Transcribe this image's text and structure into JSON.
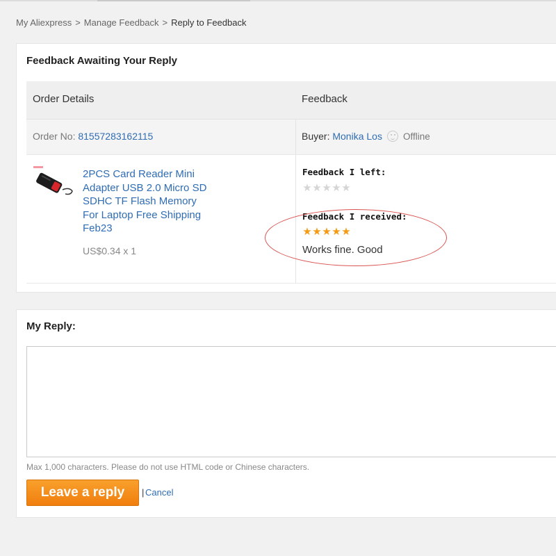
{
  "breadcrumb": {
    "items": [
      "My Aliexpress",
      "Manage Feedback",
      "Reply to Feedback"
    ],
    "separator": ">"
  },
  "awaiting": {
    "title": "Feedback Awaiting Your Reply",
    "columns": [
      "Order Details",
      "Feedback"
    ],
    "order_no_label": "Order No:",
    "order_no": "81557283162115",
    "buyer_label": "Buyer:",
    "buyer_name": "Monika Los",
    "buyer_status": "Offline",
    "product": {
      "title": "2PCS Card Reader Mini Adapter USB 2.0 Micro SD SDHC TF Flash Memory For Laptop Free Shipping Feb23",
      "price": "US$0.34 x 1",
      "thumb_icon": "card-reader-product-image"
    },
    "feedback_left_label": "Feedback I left:",
    "feedback_left_stars": 0,
    "feedback_received_label": "Feedback I received:",
    "feedback_received_stars": 5,
    "feedback_received_text": "Works fine. Good",
    "star_max": 5
  },
  "reply": {
    "title": "My Reply:",
    "value": "",
    "hint": "Max 1,000 characters. Please do not use HTML code or Chinese characters.",
    "submit_label": "Leave a reply",
    "divider": "|",
    "cancel_label": "Cancel"
  },
  "colors": {
    "link": "#2f6cb3",
    "star_active": "#f59a13",
    "star_inactive": "#d5d5d5",
    "button": "#f5901d",
    "annotation_circle": "#d9534f"
  }
}
